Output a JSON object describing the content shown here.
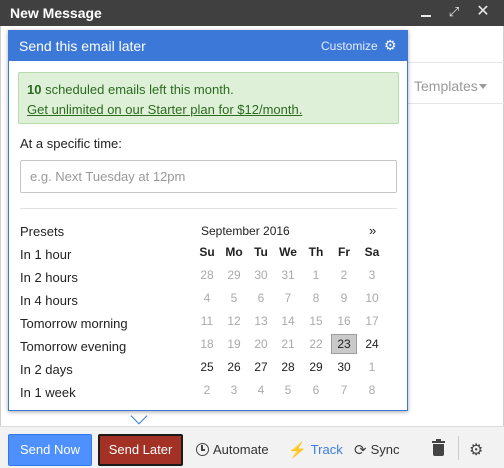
{
  "compose": {
    "title": "New Message",
    "controls": {
      "minimize": "",
      "expand": "⤢",
      "close": "✕"
    },
    "templates_label": "Templates"
  },
  "popup": {
    "title": "Send this email later",
    "customize_label": "Customize",
    "notice": {
      "count": "10",
      "text": " scheduled emails left this month.",
      "link": "Get unlimited on our Starter plan for $12/month."
    },
    "specific_time_label": "At a specific time:",
    "time_input": {
      "placeholder": "e.g. Next Tuesday at 12pm",
      "value": ""
    },
    "presets_title": "Presets",
    "presets": [
      "In 1 hour",
      "In 2 hours",
      "In 4 hours",
      "Tomorrow morning",
      "Tomorrow evening",
      "In 2 days",
      "In 1 week"
    ],
    "calendar": {
      "month_label": "September 2016",
      "next_label": "»",
      "weekdays": [
        "Su",
        "Mo",
        "Tu",
        "We",
        "Th",
        "Fr",
        "Sa"
      ],
      "weeks": [
        [
          [
            "28",
            true
          ],
          [
            "29",
            true
          ],
          [
            "30",
            true
          ],
          [
            "31",
            true
          ],
          [
            "1",
            true
          ],
          [
            "2",
            true
          ],
          [
            "3",
            true
          ]
        ],
        [
          [
            "4",
            true
          ],
          [
            "5",
            true
          ],
          [
            "6",
            true
          ],
          [
            "7",
            true
          ],
          [
            "8",
            true
          ],
          [
            "9",
            true
          ],
          [
            "10",
            true
          ]
        ],
        [
          [
            "11",
            true
          ],
          [
            "12",
            true
          ],
          [
            "13",
            true
          ],
          [
            "14",
            true
          ],
          [
            "15",
            true
          ],
          [
            "16",
            true
          ],
          [
            "17",
            true
          ]
        ],
        [
          [
            "18",
            true
          ],
          [
            "19",
            true
          ],
          [
            "20",
            true
          ],
          [
            "21",
            true
          ],
          [
            "22",
            true
          ],
          [
            "23",
            false
          ],
          [
            "24",
            false
          ]
        ],
        [
          [
            "25",
            false
          ],
          [
            "26",
            false
          ],
          [
            "27",
            false
          ],
          [
            "28",
            false
          ],
          [
            "29",
            false
          ],
          [
            "30",
            false
          ],
          [
            "1",
            true
          ]
        ],
        [
          [
            "2",
            true
          ],
          [
            "3",
            true
          ],
          [
            "4",
            true
          ],
          [
            "5",
            true
          ],
          [
            "6",
            true
          ],
          [
            "7",
            true
          ],
          [
            "8",
            true
          ]
        ]
      ],
      "selected_day": "23"
    }
  },
  "toolbar": {
    "send_now": "Send Now",
    "send_later": "Send Later",
    "automate": "Automate",
    "track": "Track",
    "sync": "Sync"
  },
  "colors": {
    "popup_header": "#3b78d8",
    "send_now": "#4d90fe",
    "send_later": "#a33126",
    "notice_bg": "#dff0d8",
    "track": "#3a7ddc"
  },
  "icons": {
    "customize": "gear-icon",
    "automate": "clock-icon",
    "track": "bolt-icon",
    "sync": "sync-icon",
    "delete": "trash-icon",
    "settings": "gear-icon"
  }
}
